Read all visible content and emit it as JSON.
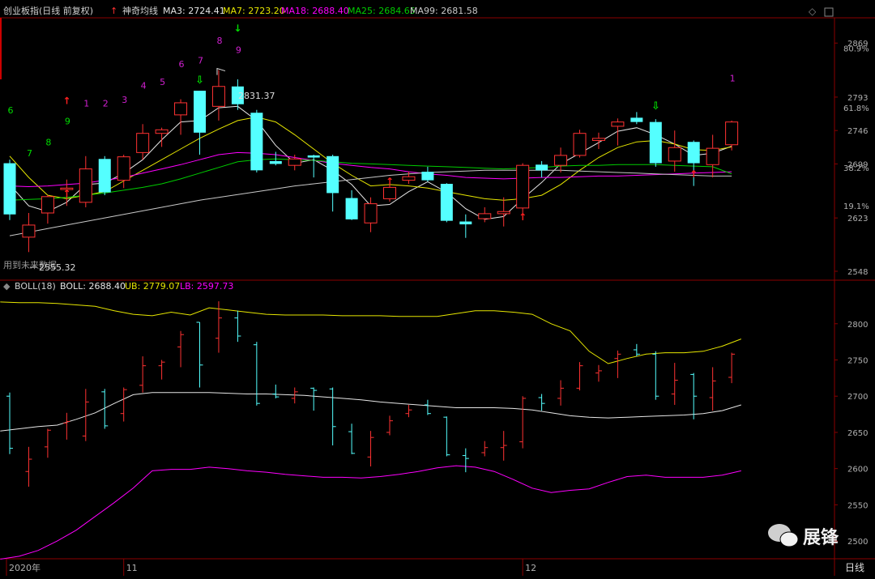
{
  "header": {
    "title": "创业板指(日线 前复权)",
    "indicator": "神奇均线",
    "ma3": "MA3: 2724.41",
    "ma7": "MA7: 2723.20",
    "ma18": "MA18: 2688.40",
    "ma25": "MA25: 2684.65",
    "ma99": "MA99: 2681.58"
  },
  "boll_header": {
    "title": "BOLL(18)",
    "boll": "BOLL: 2688.40",
    "ub": "UB: 2779.07",
    "lb": "LB: 2597.73"
  },
  "labels": {
    "high_label": "2831.37",
    "low_label": "2555.32",
    "left_note": "用到未来数据",
    "period": "日线",
    "watermark": "展锋"
  },
  "colors": {
    "up": "#ff3232",
    "down": "#54ffff",
    "ma3": "#e6e6e6",
    "ma7": "#e6e600",
    "ma18": "#ff00ff",
    "ma25": "#00cc00",
    "ma99": "#c8c8c8",
    "grid": "#8b0000",
    "axis_text": "#b0b0b0"
  },
  "chart_data": [
    {
      "type": "candlestick",
      "name": "main",
      "ylim": [
        2540,
        2900
      ],
      "y_ticks": [
        2548,
        2623,
        2699,
        2746,
        2793,
        2869
      ],
      "pct_ticks": [
        {
          "value": 2640,
          "label": "19.1%"
        },
        {
          "value": 2694,
          "label": "38.2%"
        },
        {
          "value": 2778,
          "label": "61.8%"
        },
        {
          "value": 2862,
          "label": "80.9%"
        }
      ],
      "x_labels": [
        {
          "index": 0,
          "label": "2020年"
        },
        {
          "index": 6,
          "label": "11"
        },
        {
          "index": 27,
          "label": "12"
        }
      ],
      "candles": [
        {
          "o": 2700,
          "h": 2705,
          "l": 2620,
          "c": 2628
        },
        {
          "o": 2596,
          "h": 2630,
          "l": 2575,
          "c": 2613
        },
        {
          "o": 2630,
          "h": 2655,
          "l": 2615,
          "c": 2653
        },
        {
          "o": 2663,
          "h": 2677,
          "l": 2640,
          "c": 2665
        },
        {
          "o": 2645,
          "h": 2710,
          "l": 2638,
          "c": 2692
        },
        {
          "o": 2706,
          "h": 2710,
          "l": 2655,
          "c": 2659
        },
        {
          "o": 2676,
          "h": 2712,
          "l": 2665,
          "c": 2709
        },
        {
          "o": 2715,
          "h": 2755,
          "l": 2705,
          "c": 2742
        },
        {
          "o": 2742,
          "h": 2750,
          "l": 2723,
          "c": 2747
        },
        {
          "o": 2768,
          "h": 2790,
          "l": 2740,
          "c": 2785
        },
        {
          "o": 2802,
          "h": 2802,
          "l": 2712,
          "c": 2743
        },
        {
          "o": 2780,
          "h": 2831,
          "l": 2760,
          "c": 2808
        },
        {
          "o": 2808,
          "h": 2818,
          "l": 2775,
          "c": 2783
        },
        {
          "o": 2771,
          "h": 2775,
          "l": 2687,
          "c": 2690
        },
        {
          "o": 2703,
          "h": 2716,
          "l": 2697,
          "c": 2699
        },
        {
          "o": 2697,
          "h": 2712,
          "l": 2690,
          "c": 2706
        },
        {
          "o": 2711,
          "h": 2712,
          "l": 2680,
          "c": 2708
        },
        {
          "o": 2710,
          "h": 2712,
          "l": 2632,
          "c": 2658
        },
        {
          "o": 2651,
          "h": 2662,
          "l": 2620,
          "c": 2621
        },
        {
          "o": 2616,
          "h": 2652,
          "l": 2603,
          "c": 2643
        },
        {
          "o": 2650,
          "h": 2673,
          "l": 2646,
          "c": 2666
        },
        {
          "o": 2676,
          "h": 2688,
          "l": 2671,
          "c": 2681
        },
        {
          "o": 2688,
          "h": 2695,
          "l": 2674,
          "c": 2676
        },
        {
          "o": 2671,
          "h": 2672,
          "l": 2617,
          "c": 2619
        },
        {
          "o": 2618,
          "h": 2628,
          "l": 2595,
          "c": 2614
        },
        {
          "o": 2622,
          "h": 2638,
          "l": 2617,
          "c": 2629
        },
        {
          "o": 2629,
          "h": 2652,
          "l": 2611,
          "c": 2632
        },
        {
          "o": 2637,
          "h": 2700,
          "l": 2628,
          "c": 2697
        },
        {
          "o": 2698,
          "h": 2703,
          "l": 2680,
          "c": 2690
        },
        {
          "o": 2697,
          "h": 2722,
          "l": 2687,
          "c": 2711
        },
        {
          "o": 2711,
          "h": 2747,
          "l": 2708,
          "c": 2742
        },
        {
          "o": 2732,
          "h": 2743,
          "l": 2720,
          "c": 2735
        },
        {
          "o": 2752,
          "h": 2763,
          "l": 2725,
          "c": 2758
        },
        {
          "o": 2764,
          "h": 2772,
          "l": 2755,
          "c": 2758
        },
        {
          "o": 2758,
          "h": 2762,
          "l": 2695,
          "c": 2700
        },
        {
          "o": 2703,
          "h": 2746,
          "l": 2688,
          "c": 2722
        },
        {
          "o": 2730,
          "h": 2732,
          "l": 2668,
          "c": 2700
        },
        {
          "o": 2698,
          "h": 2740,
          "l": 2680,
          "c": 2721
        },
        {
          "o": 2726,
          "h": 2760,
          "l": 2718,
          "c": 2758
        }
      ],
      "moving_averages": {
        "MA3": [
          2670,
          2640,
          2632,
          2645,
          2670,
          2672,
          2686,
          2705,
          2733,
          2758,
          2760,
          2778,
          2780,
          2760,
          2725,
          2700,
          2705,
          2690,
          2670,
          2640,
          2642,
          2660,
          2674,
          2659,
          2636,
          2621,
          2625,
          2650,
          2673,
          2699,
          2714,
          2729,
          2745,
          2750,
          2740,
          2727,
          2711,
          2714,
          2724
        ],
        "MA7": [
          2710,
          2680,
          2655,
          2650,
          2655,
          2660,
          2675,
          2690,
          2705,
          2720,
          2735,
          2748,
          2760,
          2765,
          2758,
          2740,
          2720,
          2700,
          2683,
          2668,
          2670,
          2668,
          2665,
          2660,
          2655,
          2650,
          2648,
          2650,
          2655,
          2670,
          2690,
          2708,
          2722,
          2730,
          2732,
          2727,
          2719,
          2718,
          2723
        ],
        "MA18": [
          2668,
          2667,
          2668,
          2670,
          2672,
          2676,
          2680,
          2686,
          2692,
          2698,
          2705,
          2712,
          2715,
          2714,
          2712,
          2708,
          2704,
          2700,
          2697,
          2694,
          2692,
          2688,
          2685,
          2683,
          2680,
          2679,
          2678,
          2679,
          2680,
          2680,
          2681,
          2682,
          2682,
          2683,
          2684,
          2685,
          2686,
          2687,
          2688
        ],
        "MA25": [
          2648,
          2649,
          2650,
          2652,
          2655,
          2658,
          2662,
          2666,
          2671,
          2678,
          2686,
          2694,
          2702,
          2705,
          2706,
          2705,
          2704,
          2702,
          2700,
          2699,
          2698,
          2697,
          2696,
          2695,
          2694,
          2693,
          2692,
          2693,
          2694,
          2696,
          2697,
          2697,
          2698,
          2698,
          2698,
          2697,
          2696,
          2695,
          2685
        ],
        "MA99": [
          2598,
          2603,
          2608,
          2613,
          2618,
          2623,
          2628,
          2633,
          2638,
          2643,
          2648,
          2652,
          2656,
          2660,
          2664,
          2668,
          2671,
          2674,
          2677,
          2680,
          2683,
          2685,
          2687,
          2688,
          2689,
          2690,
          2690,
          2690,
          2690,
          2690,
          2689,
          2688,
          2687,
          2686,
          2685,
          2684,
          2683,
          2682,
          2682
        ]
      },
      "annotations": [
        {
          "index": 0,
          "text": "6",
          "color": "#00dd00",
          "y": 2770
        },
        {
          "index": 1,
          "text": "7",
          "color": "#00dd00",
          "y": 2710
        },
        {
          "index": 2,
          "text": "8",
          "color": "#00dd00",
          "y": 2725
        },
        {
          "index": 3,
          "text": "9",
          "color": "#00dd00",
          "y": 2755
        },
        {
          "index": 4,
          "text": "1",
          "color": "#d020d0",
          "y": 2780
        },
        {
          "index": 5,
          "text": "2",
          "color": "#d020d0",
          "y": 2780
        },
        {
          "index": 6,
          "text": "3",
          "color": "#d020d0",
          "y": 2785
        },
        {
          "index": 7,
          "text": "4",
          "color": "#d020d0",
          "y": 2805
        },
        {
          "index": 8,
          "text": "5",
          "color": "#d020d0",
          "y": 2810
        },
        {
          "index": 9,
          "text": "6",
          "color": "#d020d0",
          "y": 2835
        },
        {
          "index": 10,
          "text": "7",
          "color": "#d020d0",
          "y": 2840
        },
        {
          "index": 11,
          "text": "8",
          "color": "#d020d0",
          "y": 2868
        },
        {
          "index": 12,
          "text": "9",
          "color": "#d020d0",
          "y": 2855
        },
        {
          "index": 38,
          "text": "1",
          "color": "#d020d0",
          "y": 2815
        }
      ],
      "arrows": [
        {
          "index": 3,
          "dir": "up",
          "color": "#ff2020",
          "y": 2653
        },
        {
          "index": 3,
          "dir": "up",
          "color": "#ff2020",
          "y": 2783
        },
        {
          "index": 12,
          "dir": "down",
          "color": "#00dd00",
          "y": 2885
        },
        {
          "index": 20,
          "dir": "up",
          "color": "#ff2020",
          "y": 2670
        },
        {
          "index": 27,
          "dir": "up",
          "color": "#ff2020",
          "y": 2620
        },
        {
          "index": 36,
          "dir": "up",
          "color": "#ff2020",
          "y": 2680
        },
        {
          "index": 34,
          "dir": "hollow-down",
          "color": "#00dd00",
          "y": 2776
        },
        {
          "index": 10,
          "dir": "hollow-down",
          "color": "#00dd00",
          "y": 2812
        }
      ]
    },
    {
      "type": "boll",
      "name": "BOLL(18)",
      "ylim": [
        2480,
        2840
      ],
      "y_ticks": [
        2500,
        2550,
        2600,
        2650,
        2700,
        2750,
        2800
      ],
      "ub": [
        2830,
        2829,
        2829,
        2828,
        2826,
        2824,
        2818,
        2813,
        2811,
        2816,
        2812,
        2822,
        2819,
        2816,
        2813,
        2812,
        2812,
        2812,
        2811,
        2811,
        2811,
        2810,
        2810,
        2810,
        2814,
        2818,
        2818,
        2816,
        2813,
        2800,
        2790,
        2762,
        2745,
        2752,
        2758,
        2760,
        2760,
        2762,
        2769,
        2779
      ],
      "mid": [
        2652,
        2655,
        2658,
        2660,
        2668,
        2677,
        2690,
        2702,
        2705,
        2705,
        2705,
        2705,
        2704,
        2703,
        2703,
        2702,
        2701,
        2699,
        2697,
        2695,
        2692,
        2690,
        2688,
        2686,
        2684,
        2684,
        2684,
        2683,
        2681,
        2677,
        2673,
        2671,
        2670,
        2671,
        2672,
        2673,
        2674,
        2676,
        2680,
        2688
      ],
      "lb": [
        2475,
        2479,
        2487,
        2500,
        2515,
        2534,
        2553,
        2573,
        2597,
        2599,
        2599,
        2602,
        2600,
        2597,
        2595,
        2592,
        2590,
        2588,
        2588,
        2587,
        2589,
        2592,
        2596,
        2601,
        2604,
        2602,
        2596,
        2585,
        2573,
        2567,
        2570,
        2572,
        2581,
        2589,
        2591,
        2588,
        2588,
        2588,
        2591,
        2597
      ]
    }
  ]
}
